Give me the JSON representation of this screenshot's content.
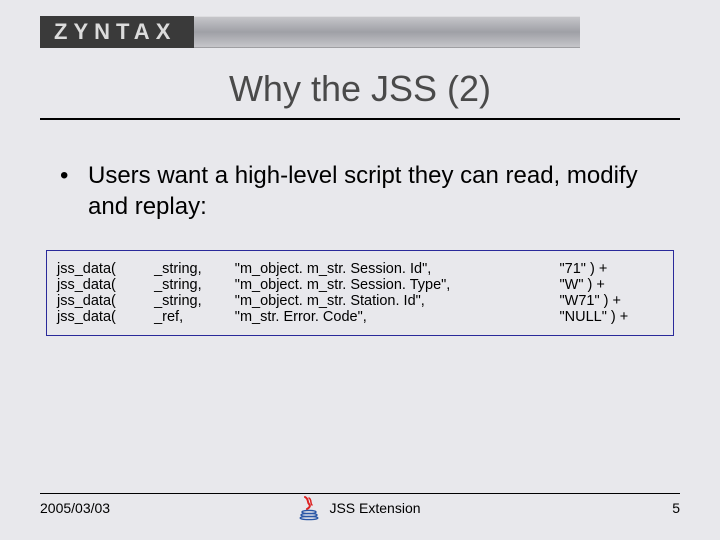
{
  "logo": {
    "text": "ZYNTAX"
  },
  "title": "Why the JSS (2)",
  "bullet": "Users want a high-level script they can read, modify and replay:",
  "code": {
    "rows": [
      {
        "fn": "jss_data(",
        "type": "_string,",
        "path": "\"m_object. m_str. Session. Id\",",
        "val": "\"71\" ) +"
      },
      {
        "fn": "jss_data(",
        "type": "_string,",
        "path": "\"m_object. m_str. Session. Type\",",
        "val": "\"W\" ) +"
      },
      {
        "fn": "jss_data(",
        "type": "_string,",
        "path": "\"m_object. m_str. Station. Id\",",
        "val": "\"W71\" ) +"
      },
      {
        "fn": "jss_data(",
        "type": "_ref,",
        "path": "\"m_str. Error. Code\",",
        "val": "\"NULL\" ) +"
      }
    ]
  },
  "footer": {
    "date": "2005/03/03",
    "center_label": "JSS Extension",
    "page": "5"
  }
}
